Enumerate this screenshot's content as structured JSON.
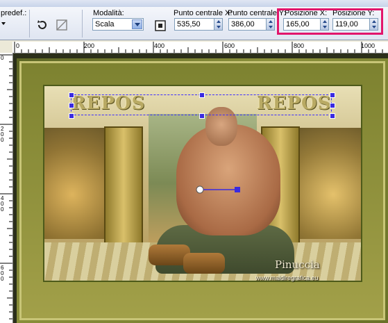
{
  "toolbar": {
    "preset_label": "predef.:",
    "mode_label": "Modalità:",
    "mode_value": "Scala",
    "center_x_label": "Punto centrale X:",
    "center_x_value": "535,50",
    "center_y_label": "Punto centrale Y:",
    "center_y_value": "386,00",
    "pos_x_label": "Posizione X:",
    "pos_x_value": "165,00",
    "pos_y_label": "Posizione Y:",
    "pos_y_value": "119,00"
  },
  "ruler": {
    "h_labels": [
      "0",
      "200",
      "400",
      "600",
      "800",
      "1000"
    ],
    "v_labels": [
      "0",
      "200",
      "400",
      "600"
    ]
  },
  "image": {
    "title_left": "REPOS",
    "title_right": "REPOS",
    "signature": "Pinuccia",
    "site": "www.maidiregrafica.eu"
  },
  "colors": {
    "highlight": "#e2156b",
    "selection": "#3a2be0"
  }
}
